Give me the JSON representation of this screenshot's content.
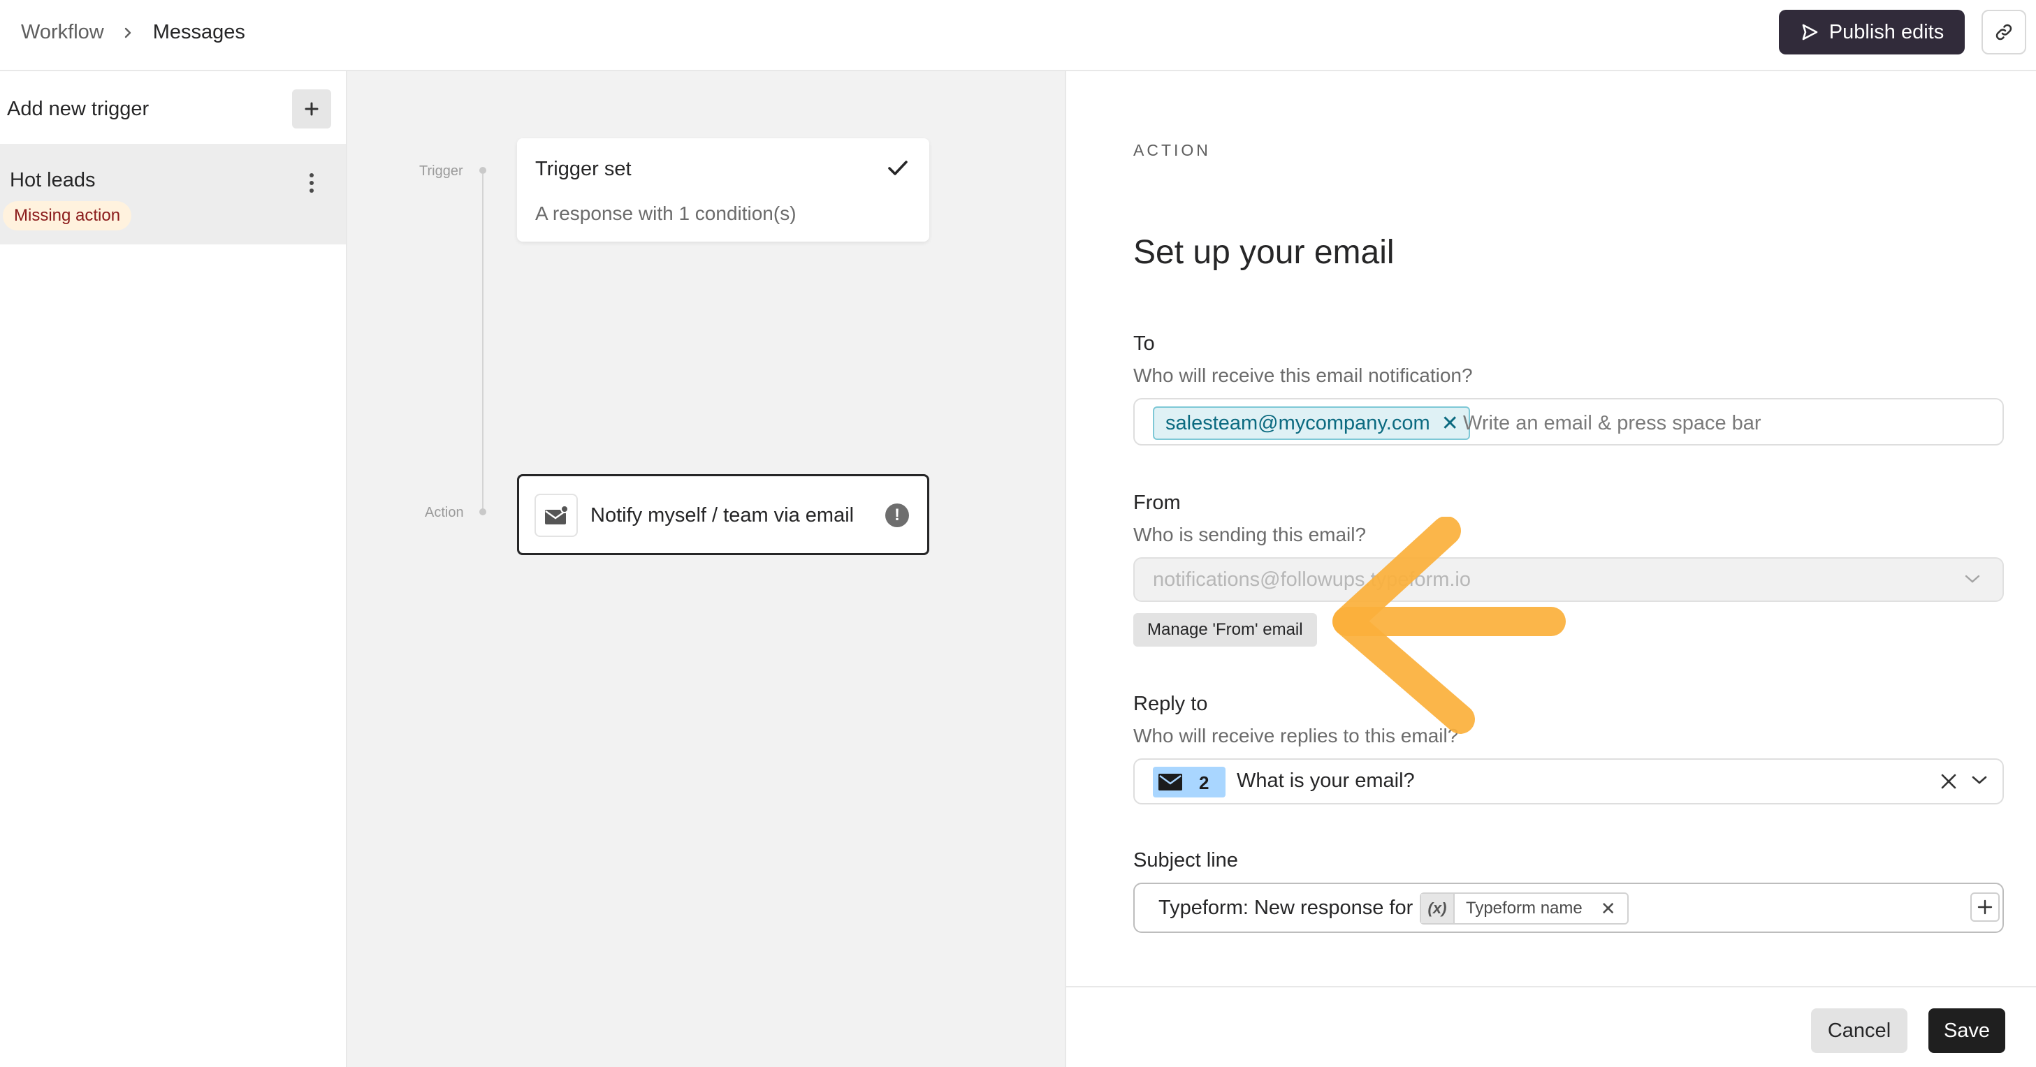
{
  "breadcrumb": {
    "root": "Workflow",
    "current": "Messages"
  },
  "header": {
    "publish_label": "Publish edits"
  },
  "sidebar": {
    "add_trigger_label": "Add new trigger",
    "items": [
      {
        "name": "Hot leads",
        "badge": "Missing action"
      }
    ]
  },
  "canvas": {
    "trigger_step_label": "Trigger",
    "action_step_label": "Action",
    "trigger_card": {
      "title": "Trigger set",
      "subtitle": "A response with 1 condition(s)"
    },
    "action_card": {
      "title": "Notify myself / team via email",
      "warning_icon": "exclamation-icon"
    }
  },
  "panel": {
    "eyebrow": "ACTION",
    "title": "Set up your email",
    "to": {
      "label": "To",
      "help": "Who will receive this email notification?",
      "chips": [
        "salesteam@mycompany.com"
      ],
      "placeholder": "Write an email & press space bar"
    },
    "from": {
      "label": "From",
      "help": "Who is sending this email?",
      "value": "notifications@followups.typeform.io",
      "manage_label": "Manage 'From' email"
    },
    "reply_to": {
      "label": "Reply to",
      "help": "Who will receive replies to this email?",
      "question_number": "2",
      "question_text": "What is your email?"
    },
    "subject": {
      "label": "Subject line",
      "prefix": "Typeform: New response for",
      "variable_icon": "(x)",
      "variable_name": "Typeform name"
    },
    "cancel_label": "Cancel",
    "save_label": "Save"
  },
  "colors": {
    "publish_bg": "#312b3a",
    "badge_bg": "#fff2de",
    "badge_text": "#8a1a1a",
    "chip_bg": "#dff1f5",
    "chip_text": "#0b6a80",
    "reply_chip_bg": "#a9d6ff",
    "annotation_arrow": "#fbb03b"
  }
}
